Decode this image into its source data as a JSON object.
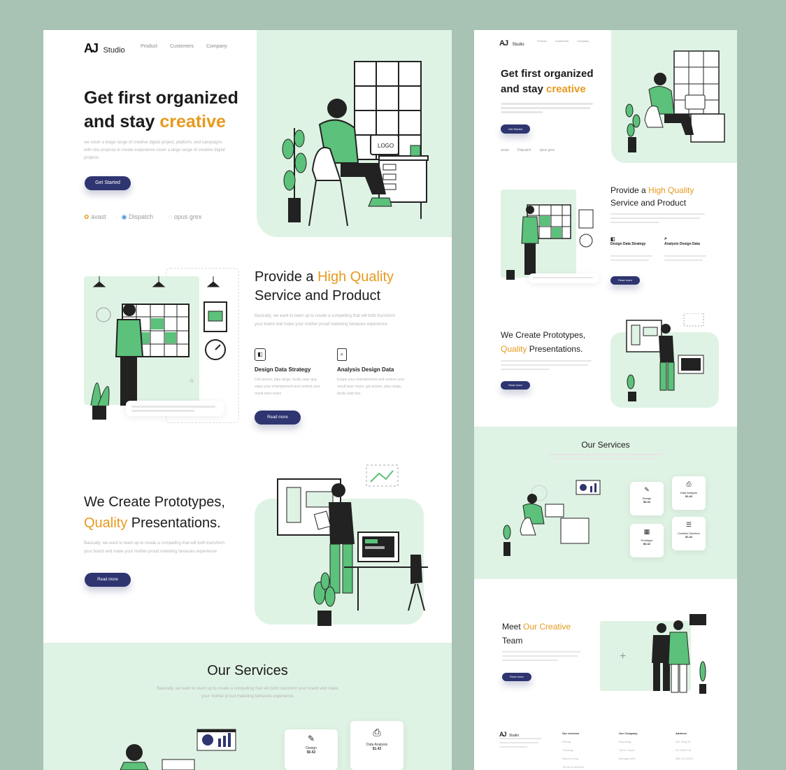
{
  "brand": {
    "logo_mark": "AJ",
    "name": "Studio"
  },
  "nav": [
    "Product",
    "Customers",
    "Company"
  ],
  "hero": {
    "title_line1": "Get first organized",
    "title_line2_prefix": "and stay ",
    "title_line2_highlight": "creative",
    "description": "we cover a leage range of creative digital project, platform, and campaigns with one propose to create experience cover a large range of creative digital projects",
    "cta": "Get Started"
  },
  "partners": [
    "avast",
    "Dispatch",
    "opus grex"
  ],
  "quality": {
    "title_prefix": "Provide a ",
    "title_highlight": "High Quality",
    "title_line2": "Service and Product",
    "description": "Basically, we want to team up to create a compelling that will both transform your brand and make your mother proud maketing fantasies experience",
    "features": [
      {
        "title": "Design Data Strategy",
        "text": "Cell ansem, plau range, facilis usan qua vique your entertainment and content your result laser mans"
      },
      {
        "title": "Analysis Design Data",
        "text": "Enque your entertainment and content your result laser mann, get ansem, plau range, facilis arab due"
      }
    ],
    "cta": "Read more"
  },
  "prototypes": {
    "title_line1": "We Create Prototypes,",
    "title_highlight": "Quality",
    "title_line2_rest": " Presentations.",
    "description": "Basically, we want to team up to create a compelling that will both transform your brand and make your mother proud maketing fantasies experience",
    "cta": "Read more"
  },
  "services": {
    "title": "Our Services",
    "description": "Basically, we want to team up to create a compelling that will both transform your brand and make your mother proud maketing fantasies experience",
    "items": [
      {
        "name": "Design",
        "price": "$0.42"
      },
      {
        "name": "Data Analysis",
        "price": "$1.42"
      },
      {
        "name": "Prototype",
        "price": "$0.42"
      },
      {
        "name": "Creative Direction",
        "price": "$1.42"
      }
    ]
  },
  "team": {
    "title_prefix": "Meet ",
    "title_highlight": "Our Creative",
    "title_line2": "Team",
    "description": "Basically, we want to team up to create a compelling that will both transform your brand and make your mother proud maketing fantasies",
    "cta": "Read more"
  },
  "footer": {
    "columns": [
      {
        "title": "Our services",
        "items": [
          "Pricing",
          "Tracking",
          "Report a bug",
          "Terms of services"
        ]
      },
      {
        "title": "Our Company",
        "items": [
          "Reporting",
          "Get in Touch",
          "Management"
        ]
      },
      {
        "title": "Address",
        "items": [
          "321 Ring St.",
          "NC 8399 US",
          "888-123-4329"
        ]
      }
    ]
  },
  "colors": {
    "accent": "#e79a1e",
    "primary": "#2e3571",
    "green": "#5cc17a",
    "mint": "#dff3e4",
    "background": "#a8c3b4"
  }
}
